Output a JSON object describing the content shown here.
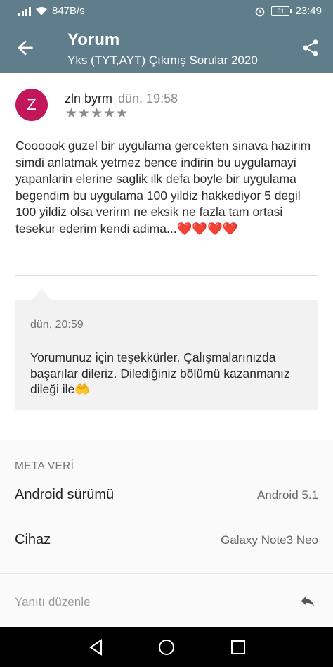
{
  "status_bar": {
    "network_speed": "847B/s",
    "battery": "31",
    "time": "23:49"
  },
  "app_bar": {
    "title": "Yorum",
    "subtitle": "Yks (TYT,AYT) Çıkmış Sorular 2020",
    "back_icon": "arrow-back-icon",
    "share_icon": "share-icon"
  },
  "review": {
    "avatar_letter": "Z",
    "avatar_color": "#c2185b",
    "author": "zln byrm",
    "date": "dün, 19:58",
    "stars": "★★★★★",
    "rating": 5,
    "text": "Coooook guzel bir uygulama gercekten sinava hazirim simdi anlatmak yetmez bence indirin bu uygulamayi yapanlarin elerine saglik ilk defa boyle bir uygulama begendim bu uygulama 100 yildiz hakkediyor 5 degil 100 yildiz olsa verirm ne eksik ne fazla tam ortasi tesekur ederim kendi adima...❤️❤️❤️❤️"
  },
  "reply": {
    "date": "dün, 20:59",
    "text": "Yorumunuz için teşekkürler. Çalışmalarınızda başarılar dileriz. Dilediğiniz bölümü kazanmanız dileği ile🤲"
  },
  "meta": {
    "title": "META VERİ",
    "rows": [
      {
        "label": "Android sürümü",
        "value": "Android 5.1"
      },
      {
        "label": "Cihaz",
        "value": "Galaxy Note3 Neo"
      }
    ]
  },
  "edit_bar": {
    "label": "Yanıtı düzenle",
    "icon": "reply-icon"
  },
  "nav_bar": {
    "back": "nav-back-icon",
    "home": "nav-home-icon",
    "recents": "nav-recents-icon"
  },
  "colors": {
    "app_bar": "#607d8b",
    "reply_bg": "#f2f2f2",
    "heart": "#d32f2f"
  }
}
